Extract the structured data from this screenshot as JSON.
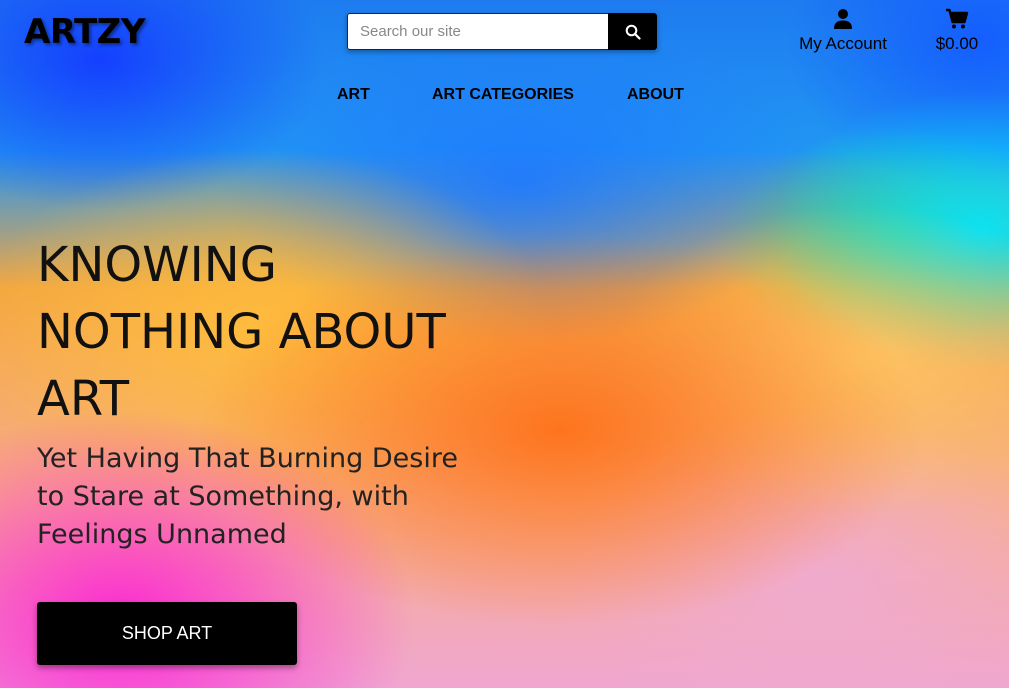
{
  "brand": {
    "logo_text": "ARTZY"
  },
  "search": {
    "placeholder": "Search our site",
    "value": "",
    "icon": "search-icon"
  },
  "account": {
    "icon": "user-icon",
    "label": "My Account"
  },
  "cart": {
    "icon": "cart-icon",
    "total": "$0.00"
  },
  "nav": {
    "items": [
      {
        "label": "ART"
      },
      {
        "label": "ART CATEGORIES"
      },
      {
        "label": "ABOUT"
      }
    ]
  },
  "hero": {
    "title": "KNOWING NOTHING ABOUT ART",
    "subtitle": "Yet Having That Burning Desire to Stare at Something, with Feelings Unnamed",
    "cta_label": "SHOP ART"
  },
  "colors": {
    "button_bg": "#000000",
    "button_text": "#ffffff"
  }
}
